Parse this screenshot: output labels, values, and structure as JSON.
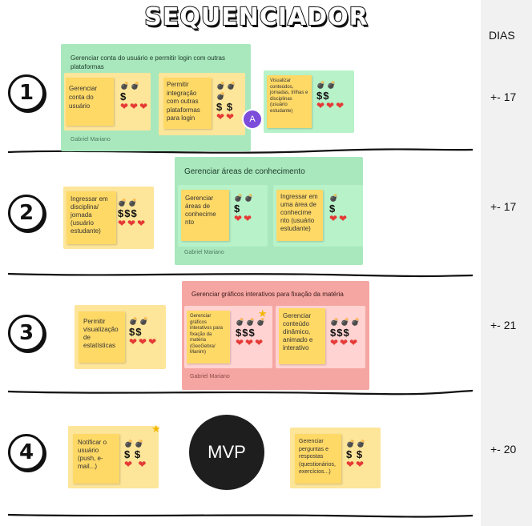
{
  "title": "SEQUENCIADOR",
  "dias_label": "DIAS",
  "rows": [
    {
      "number": "1",
      "days": "+- 17"
    },
    {
      "number": "2",
      "days": "+- 17"
    },
    {
      "number": "3",
      "days": "+- 21"
    },
    {
      "number": "4",
      "days": "+- 20"
    }
  ],
  "frames": {
    "f1": {
      "title": "Gerenciar conta do usuário e permitir login com outras plataformas",
      "footer": "Gabriel Mariano"
    },
    "f2": {
      "title": "Gerenciar áreas de conhecimento",
      "footer": "Gabriel Mariano"
    },
    "f3": {
      "title": "Gerenciar gráficos interativos para fixação da matéria",
      "footer": "Gabriel Mariano"
    }
  },
  "avatar_initial": "A",
  "mvp_label": "MVP",
  "cards": {
    "c1": {
      "text": "Gerenciar conta do usuário",
      "bombs": "💣💣",
      "money": "$",
      "hearts": "❤❤❤"
    },
    "c2": {
      "text": "Permitir integração com outras plataformas para login",
      "bombs": "💣💣💣",
      "money": "$ $",
      "hearts": "❤❤"
    },
    "c3": {
      "text": "Visualizar conteúdos, jornadas, trilhas e disciplinas (usuário estudante)",
      "bombs": "💣💣",
      "money": "$$",
      "hearts": "❤❤❤"
    },
    "c4": {
      "text": "Ingressar em disciplina/ jornada  (usuário estudante)",
      "bombs": "💣💣",
      "money": "$$$",
      "hearts": "❤❤❤"
    },
    "c5": {
      "text": "Gerenciar áreas de conhecime nto",
      "bombs": "💣💣",
      "money": "$",
      "hearts": "❤❤"
    },
    "c6": {
      "text": "Ingressar em uma área de conhecime nto (usuário estudante)",
      "bombs": "💣",
      "money": "$",
      "hearts": "❤❤"
    },
    "c7": {
      "text": "Permitir visualização de estatísticas",
      "bombs": "💣💣",
      "money": "$$",
      "hearts": "❤❤❤"
    },
    "c8": {
      "text": "Gerenciar gráficos interativos para fixação da matéria (GeoGebra/ Manim)",
      "bombs": "💣💣💣",
      "money": "$$$",
      "hearts": "❤❤❤"
    },
    "c9": {
      "text": "Gerenciar conteúdo dinâmico, animado e interativo",
      "bombs": "💣💣💣",
      "money": "$$$",
      "hearts": "❤❤❤"
    },
    "c10": {
      "text": "Notificar o usuário (push, e-mail...)",
      "bombs": "💣💣",
      "money": "$ $",
      "hearts": "❤ ❤"
    },
    "c11": {
      "text": "Gerenciar perguntas e respostas (questionários, exercícios...)",
      "bombs": "💣💣",
      "money": "$ $",
      "hearts": "❤❤"
    }
  }
}
